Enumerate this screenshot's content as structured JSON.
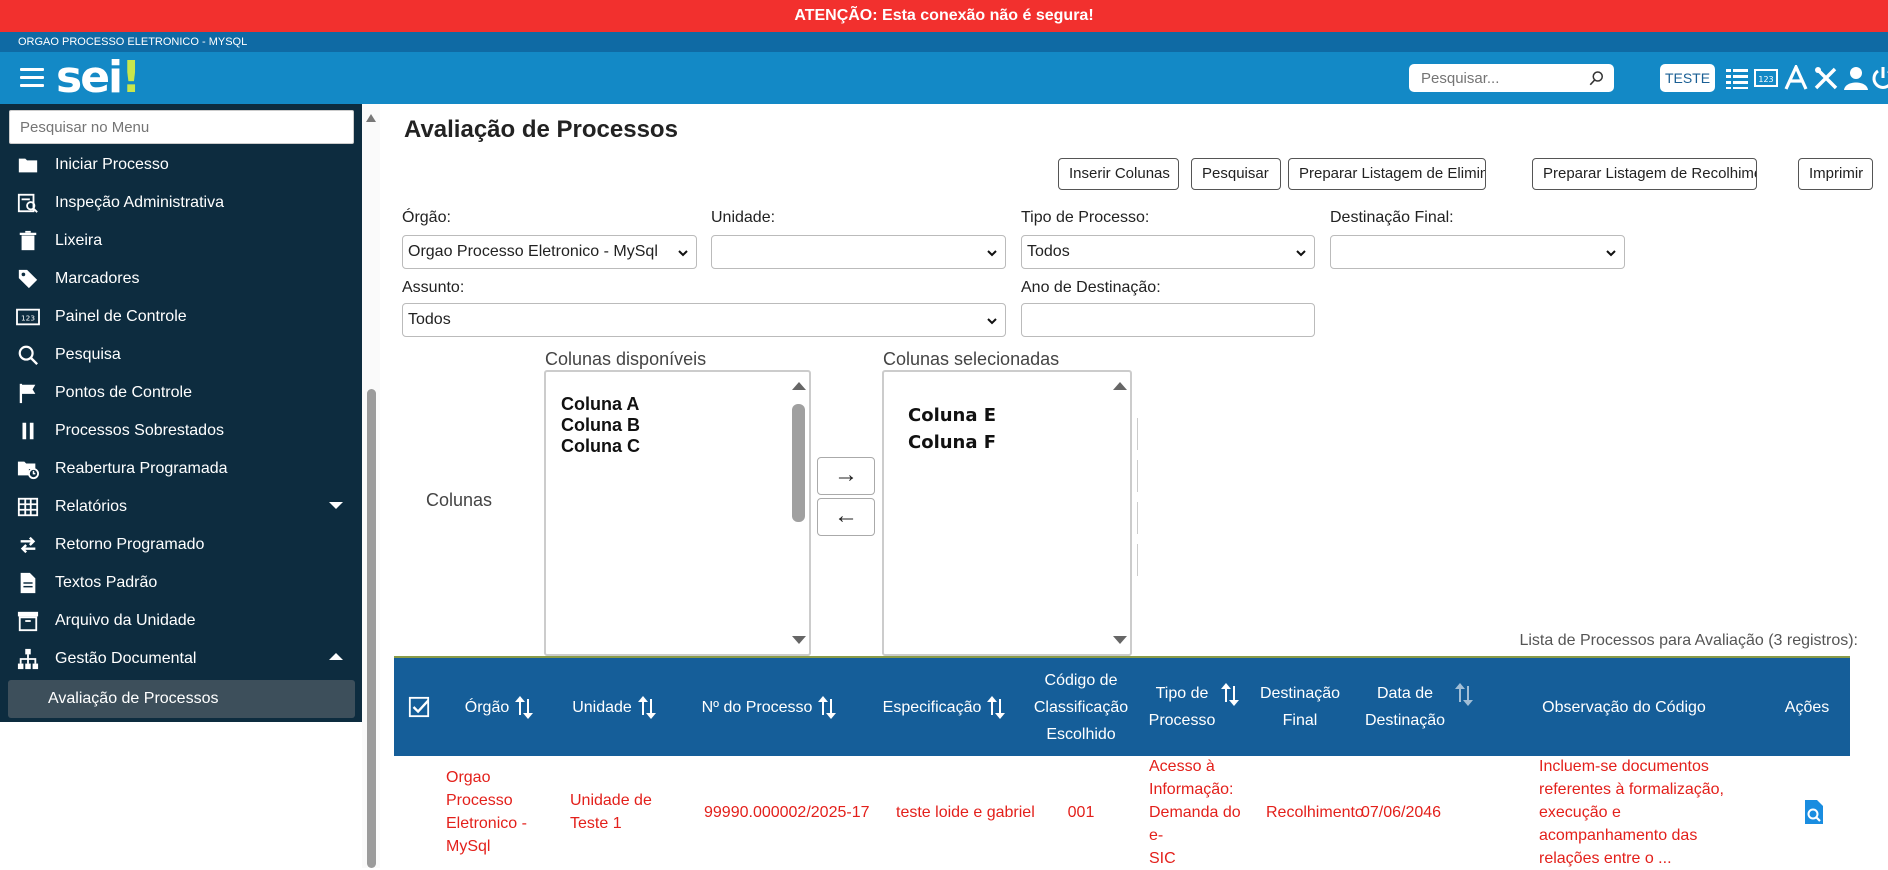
{
  "warning": "ATENÇÃO: Esta conexão não é segura!",
  "org_name": "ORGAO PROCESSO ELETRONICO - MYSQL",
  "header": {
    "logo": "sei",
    "search_placeholder": "Pesquisar...",
    "unit": "TESTE"
  },
  "sidebar": {
    "search_placeholder": "Pesquisar no Menu",
    "items": [
      {
        "label": "Iniciar Processo",
        "icon": "folder-icon"
      },
      {
        "label": "Inspeção Administrativa",
        "icon": "inspect-icon"
      },
      {
        "label": "Lixeira",
        "icon": "trash-icon"
      },
      {
        "label": "Marcadores",
        "icon": "tag-icon"
      },
      {
        "label": "Painel de Controle",
        "icon": "panel-123-icon"
      },
      {
        "label": "Pesquisa",
        "icon": "search-icon"
      },
      {
        "label": "Pontos de Controle",
        "icon": "flag-icon"
      },
      {
        "label": "Processos Sobrestados",
        "icon": "pause-icon"
      },
      {
        "label": "Reabertura Programada",
        "icon": "folder-clock-icon"
      },
      {
        "label": "Relatórios",
        "icon": "table-icon"
      },
      {
        "label": "Retorno Programado",
        "icon": "swap-icon"
      },
      {
        "label": "Textos Padrão",
        "icon": "document-icon"
      },
      {
        "label": "Arquivo da Unidade",
        "icon": "archive-icon"
      },
      {
        "label": "Gestão Documental",
        "icon": "hierarchy-icon"
      }
    ],
    "active_subitem": "Avaliação de Processos"
  },
  "page": {
    "title": "Avaliação de Processos",
    "buttons": {
      "insert_columns": "Inserir Colunas",
      "search": "Pesquisar",
      "prepare_elimination": "Preparar Listagem de Eliminação",
      "prepare_collection": "Preparar Listagem de Recolhimento",
      "print": "Imprimir"
    },
    "filters": {
      "orgao_label": "Órgão:",
      "orgao_value": "Orgao Processo Eletronico - MySql",
      "unidade_label": "Unidade:",
      "unidade_value": "",
      "tipo_label": "Tipo de Processo:",
      "tipo_value": "Todos",
      "destinacao_label": "Destinação Final:",
      "destinacao_value": "",
      "assunto_label": "Assunto:",
      "assunto_value": "Todos",
      "ano_label": "Ano de Destinação:",
      "ano_value": ""
    },
    "columns": {
      "label": "Colunas",
      "available_title": "Colunas disponíveis",
      "available": [
        "Coluna A",
        "Coluna B",
        "Coluna C"
      ],
      "selected_title": "Colunas selecionadas",
      "selected": [
        "Coluna E",
        "Coluna F"
      ],
      "move_right": "→",
      "move_left": "←"
    },
    "list_caption": "Lista de Processos para Avaliação (3 registros):",
    "table": {
      "headers": {
        "orgao": "Órgão",
        "unidade": "Unidade",
        "numero": "Nº do Processo",
        "especificacao": "Especificação",
        "codigo_1": "Código de",
        "codigo_2": "Classificação",
        "codigo_3": "Escolhido",
        "tipo_1": "Tipo de",
        "tipo_2": "Processo",
        "dest_1": "Destinação",
        "dest_2": "Final",
        "data_1": "Data de",
        "data_2": "Destinação",
        "observacao": "Observação do Código",
        "acoes": "Ações"
      },
      "rows": [
        {
          "orgao": [
            "Orgao Processo",
            "Eletronico -",
            "MySql"
          ],
          "unidade": [
            "Unidade de",
            "Teste 1"
          ],
          "numero": "99990.000002/2025-17",
          "especificacao": "teste loide e gabriel",
          "codigo": "001",
          "tipo": [
            "Acesso à",
            "Informação:",
            "Demanda do e-",
            "SIC"
          ],
          "destinacao": "Recolhimento",
          "data": "07/06/2046",
          "observacao": [
            "Incluem-se documentos",
            "referentes à formalização,",
            "execução e",
            "acompanhamento das",
            "relações entre o ..."
          ]
        }
      ]
    }
  },
  "colors": {
    "warning": "#f2302e",
    "header": "#1389c6",
    "sidebar": "#0d2c3f",
    "table_head": "#155e99",
    "row_text": "#e3201b"
  }
}
